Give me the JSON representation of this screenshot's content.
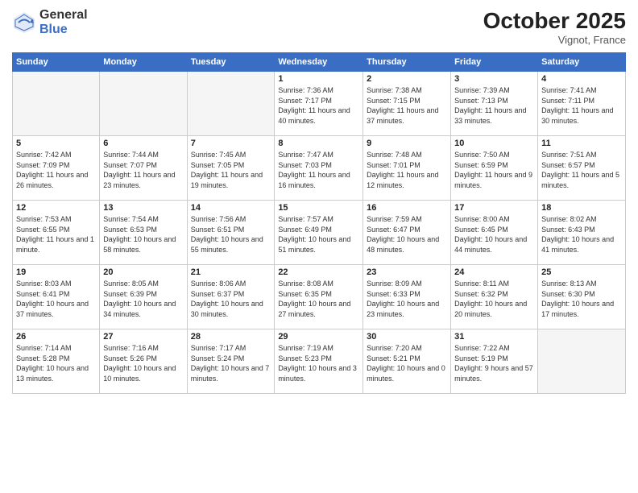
{
  "header": {
    "logo_general": "General",
    "logo_blue": "Blue",
    "month_title": "October 2025",
    "subtitle": "Vignot, France"
  },
  "days_of_week": [
    "Sunday",
    "Monday",
    "Tuesday",
    "Wednesday",
    "Thursday",
    "Friday",
    "Saturday"
  ],
  "weeks": [
    [
      {
        "day": "",
        "info": ""
      },
      {
        "day": "",
        "info": ""
      },
      {
        "day": "",
        "info": ""
      },
      {
        "day": "1",
        "info": "Sunrise: 7:36 AM\nSunset: 7:17 PM\nDaylight: 11 hours\nand 40 minutes."
      },
      {
        "day": "2",
        "info": "Sunrise: 7:38 AM\nSunset: 7:15 PM\nDaylight: 11 hours\nand 37 minutes."
      },
      {
        "day": "3",
        "info": "Sunrise: 7:39 AM\nSunset: 7:13 PM\nDaylight: 11 hours\nand 33 minutes."
      },
      {
        "day": "4",
        "info": "Sunrise: 7:41 AM\nSunset: 7:11 PM\nDaylight: 11 hours\nand 30 minutes."
      }
    ],
    [
      {
        "day": "5",
        "info": "Sunrise: 7:42 AM\nSunset: 7:09 PM\nDaylight: 11 hours\nand 26 minutes."
      },
      {
        "day": "6",
        "info": "Sunrise: 7:44 AM\nSunset: 7:07 PM\nDaylight: 11 hours\nand 23 minutes."
      },
      {
        "day": "7",
        "info": "Sunrise: 7:45 AM\nSunset: 7:05 PM\nDaylight: 11 hours\nand 19 minutes."
      },
      {
        "day": "8",
        "info": "Sunrise: 7:47 AM\nSunset: 7:03 PM\nDaylight: 11 hours\nand 16 minutes."
      },
      {
        "day": "9",
        "info": "Sunrise: 7:48 AM\nSunset: 7:01 PM\nDaylight: 11 hours\nand 12 minutes."
      },
      {
        "day": "10",
        "info": "Sunrise: 7:50 AM\nSunset: 6:59 PM\nDaylight: 11 hours\nand 9 minutes."
      },
      {
        "day": "11",
        "info": "Sunrise: 7:51 AM\nSunset: 6:57 PM\nDaylight: 11 hours\nand 5 minutes."
      }
    ],
    [
      {
        "day": "12",
        "info": "Sunrise: 7:53 AM\nSunset: 6:55 PM\nDaylight: 11 hours\nand 1 minute."
      },
      {
        "day": "13",
        "info": "Sunrise: 7:54 AM\nSunset: 6:53 PM\nDaylight: 10 hours\nand 58 minutes."
      },
      {
        "day": "14",
        "info": "Sunrise: 7:56 AM\nSunset: 6:51 PM\nDaylight: 10 hours\nand 55 minutes."
      },
      {
        "day": "15",
        "info": "Sunrise: 7:57 AM\nSunset: 6:49 PM\nDaylight: 10 hours\nand 51 minutes."
      },
      {
        "day": "16",
        "info": "Sunrise: 7:59 AM\nSunset: 6:47 PM\nDaylight: 10 hours\nand 48 minutes."
      },
      {
        "day": "17",
        "info": "Sunrise: 8:00 AM\nSunset: 6:45 PM\nDaylight: 10 hours\nand 44 minutes."
      },
      {
        "day": "18",
        "info": "Sunrise: 8:02 AM\nSunset: 6:43 PM\nDaylight: 10 hours\nand 41 minutes."
      }
    ],
    [
      {
        "day": "19",
        "info": "Sunrise: 8:03 AM\nSunset: 6:41 PM\nDaylight: 10 hours\nand 37 minutes."
      },
      {
        "day": "20",
        "info": "Sunrise: 8:05 AM\nSunset: 6:39 PM\nDaylight: 10 hours\nand 34 minutes."
      },
      {
        "day": "21",
        "info": "Sunrise: 8:06 AM\nSunset: 6:37 PM\nDaylight: 10 hours\nand 30 minutes."
      },
      {
        "day": "22",
        "info": "Sunrise: 8:08 AM\nSunset: 6:35 PM\nDaylight: 10 hours\nand 27 minutes."
      },
      {
        "day": "23",
        "info": "Sunrise: 8:09 AM\nSunset: 6:33 PM\nDaylight: 10 hours\nand 23 minutes."
      },
      {
        "day": "24",
        "info": "Sunrise: 8:11 AM\nSunset: 6:32 PM\nDaylight: 10 hours\nand 20 minutes."
      },
      {
        "day": "25",
        "info": "Sunrise: 8:13 AM\nSunset: 6:30 PM\nDaylight: 10 hours\nand 17 minutes."
      }
    ],
    [
      {
        "day": "26",
        "info": "Sunrise: 7:14 AM\nSunset: 5:28 PM\nDaylight: 10 hours\nand 13 minutes."
      },
      {
        "day": "27",
        "info": "Sunrise: 7:16 AM\nSunset: 5:26 PM\nDaylight: 10 hours\nand 10 minutes."
      },
      {
        "day": "28",
        "info": "Sunrise: 7:17 AM\nSunset: 5:24 PM\nDaylight: 10 hours\nand 7 minutes."
      },
      {
        "day": "29",
        "info": "Sunrise: 7:19 AM\nSunset: 5:23 PM\nDaylight: 10 hours\nand 3 minutes."
      },
      {
        "day": "30",
        "info": "Sunrise: 7:20 AM\nSunset: 5:21 PM\nDaylight: 10 hours\nand 0 minutes."
      },
      {
        "day": "31",
        "info": "Sunrise: 7:22 AM\nSunset: 5:19 PM\nDaylight: 9 hours\nand 57 minutes."
      },
      {
        "day": "",
        "info": ""
      }
    ]
  ]
}
